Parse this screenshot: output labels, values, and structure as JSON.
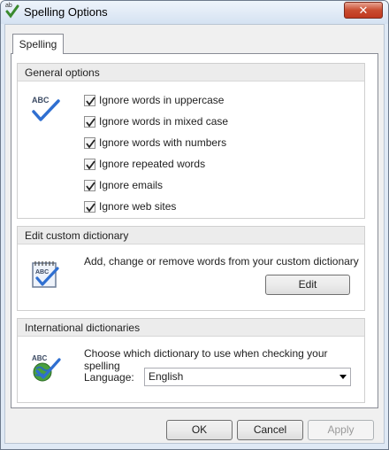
{
  "window": {
    "title": "Spelling Options",
    "close_label": "✕"
  },
  "app_icon_text": "ab",
  "tabs": [
    {
      "label": "Spelling"
    }
  ],
  "general": {
    "header": "General options",
    "icon_text": "ABC",
    "options": [
      {
        "label": "Ignore words in uppercase",
        "checked": true
      },
      {
        "label": "Ignore words in mixed case",
        "checked": true
      },
      {
        "label": "Ignore words with numbers",
        "checked": true
      },
      {
        "label": "Ignore repeated words",
        "checked": true
      },
      {
        "label": "Ignore emails",
        "checked": true
      },
      {
        "label": "Ignore web sites",
        "checked": true
      }
    ]
  },
  "custom_dictionary": {
    "header": "Edit custom dictionary",
    "icon_text": "ABC",
    "description": "Add, change or remove words from your custom dictionary",
    "edit_label": "Edit"
  },
  "international": {
    "header": "International dictionaries",
    "icon_text": "ABC",
    "description": "Choose which dictionary to use when checking your spelling",
    "language_label": "Language:",
    "language_value": "English"
  },
  "buttons": {
    "ok": "OK",
    "cancel": "Cancel",
    "apply": "Apply"
  }
}
